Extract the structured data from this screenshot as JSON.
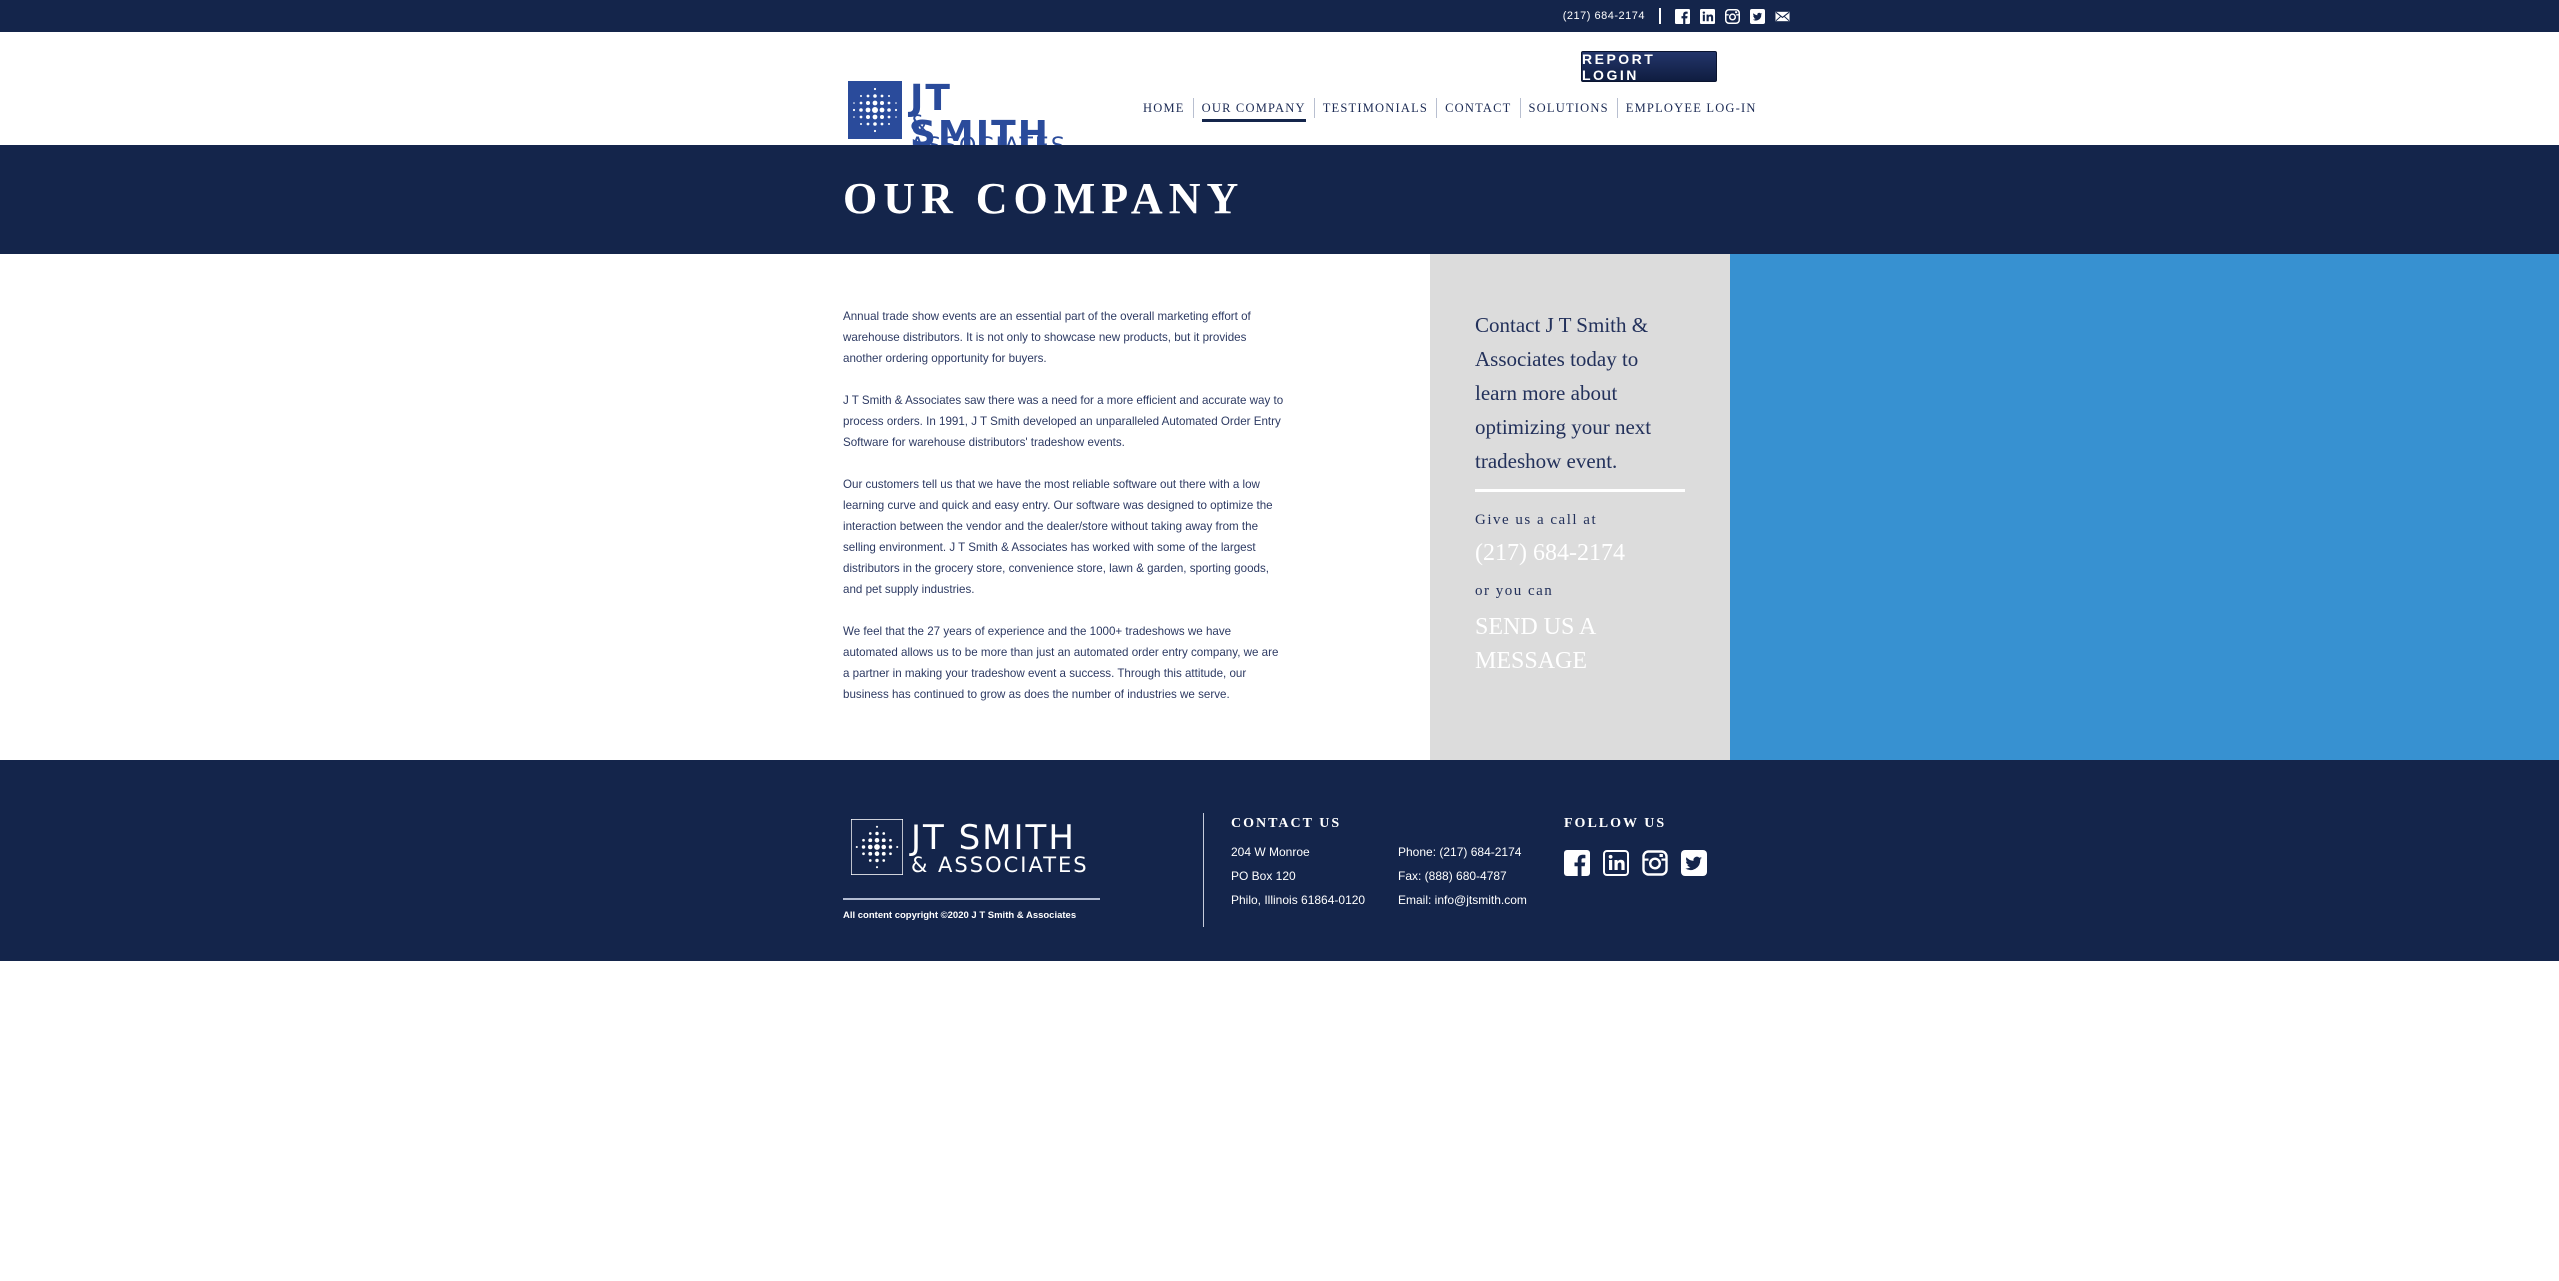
{
  "topbar": {
    "phone": "(217) 684-2174",
    "icons": [
      "facebook-icon",
      "linkedin-icon",
      "instagram-icon",
      "twitter-icon",
      "mail-icon"
    ]
  },
  "header": {
    "logo_line1": "JT SMITH",
    "logo_line2": "& ASSOCIATES",
    "report_login": "REPORT LOGIN",
    "nav": [
      "HOME",
      "OUR COMPANY",
      "TESTIMONIALS",
      "CONTACT",
      "SOLUTIONS",
      "EMPLOYEE LOG-IN"
    ],
    "active_nav": "OUR COMPANY"
  },
  "banner": {
    "title": "OUR COMPANY"
  },
  "content": {
    "paragraphs": [
      "Annual trade show events are an essential part of the overall marketing effort of warehouse distributors. It is not only to showcase new products, but it provides another ordering opportunity for buyers.",
      "J T Smith & Associates saw there was a need for a more efficient and accurate way to process orders. In 1991, J T Smith developed an unparalleled Automated Order Entry Software for warehouse distributors' tradeshow events.",
      "Our customers tell us that we have the most reliable software out there with a low learning curve and quick and easy entry. Our software was designed to optimize the interaction between the vendor and the dealer/store without taking away from the selling environment. J T Smith & Associates has worked with some of the largest distributors in the grocery store, convenience store, lawn & garden, sporting goods, and pet supply industries.",
      "We feel that the 27 years of experience and the 1000+ tradeshows we have automated allows us to be more than just an automated order entry company, we are a partner in making your tradeshow event a success. Through this attitude, our business has continued to grow as does the number of industries we serve."
    ]
  },
  "cta": {
    "headline": "Contact J T Smith & Associates today to learn more about optimizing your next tradeshow event.",
    "give_call": "Give us a call at",
    "phone": "(217) 684-2174",
    "or_you_can": "or you can",
    "send_message": "SEND US A MESSAGE"
  },
  "footer": {
    "logo_line1": "JT SMITH",
    "logo_line2": "& ASSOCIATES",
    "copyright": "All content copyright ©2020 J T Smith & Associates",
    "contact_heading": "CONTACT US",
    "address": [
      "204 W Monroe",
      "PO Box 120",
      "Philo, Illinois 61864-0120"
    ],
    "contact_lines": [
      "Phone: (217) 684-2174",
      "Fax: (888) 680-4787",
      "Email: info@jtsmith.com"
    ],
    "follow_heading": "FOLLOW US",
    "social_icons": [
      "facebook-icon",
      "linkedin-icon",
      "instagram-icon",
      "twitter-icon"
    ]
  },
  "colors": {
    "navy": "#14254b",
    "accent_blue": "#3791d1",
    "panel_gray": "#dcdcdc",
    "logo_blue": "#2a4b9b"
  }
}
